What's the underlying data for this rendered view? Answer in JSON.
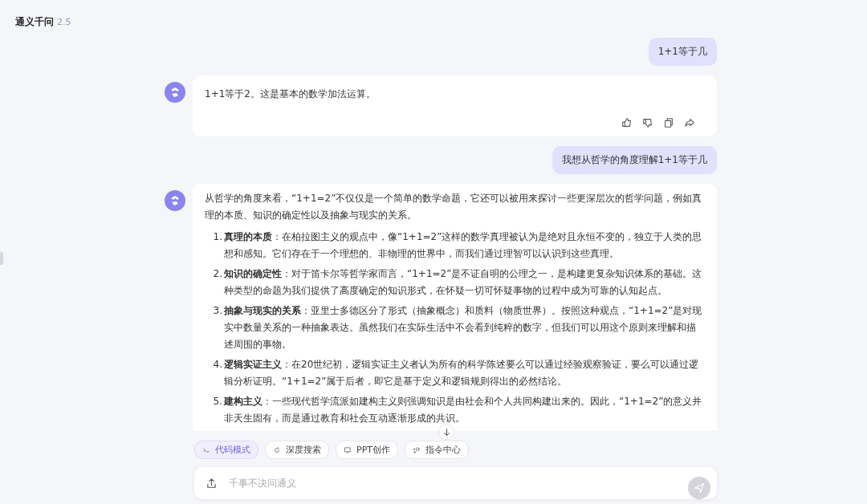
{
  "header": {
    "title": "通义千问",
    "version": "2.5"
  },
  "messages": [
    {
      "kind": "user",
      "text": "1+1等于几"
    },
    {
      "kind": "bot",
      "intro": "1+1等于2。这是基本的数学加法运算。",
      "actions": true
    },
    {
      "kind": "user",
      "text": "我想从哲学的角度理解1+1等于几"
    },
    {
      "kind": "bot",
      "intro": "从哲学的角度来看，“1+1=2”不仅仅是一个简单的数学命题，它还可以被用来探讨一些更深层次的哲学问题，例如真理的本质、知识的确定性以及抽象与现实的关系。",
      "items": [
        {
          "number": "1.",
          "text": "**真理的本质**：在柏拉图主义的观点中，像“1+1=2”这样的数学真理被认为是绝对且永恒不变的，独立于人类的思想和感知。它们存在于一个理想的、非物理的世界中，而我们通过理智可以认识到这些真理。"
        },
        {
          "number": "2.",
          "text": "**知识的确定性**：对于笛卡尔等哲学家而言，“1+1=2”是不证自明的公理之一，是构建更复杂知识体系的基础。这种类型的命题为我们提供了高度确定的知识形式，在怀疑一切可怀疑事物的过程中成为可靠的认知起点。"
        },
        {
          "number": "3.",
          "text": "**抽象与现实的关系**：亚里士多德区分了形式（抽象概念）和质料（物质世界）。按照这种观点，“1+1=2”是对现实中数量关系的一种抽象表达。虽然我们在实际生活中不会看到纯粹的数字，但我们可以用这个原则来理解和描述周围的事物。"
        },
        {
          "number": "4.",
          "text": "**逻辑实证主义**：在20世纪初，逻辑实证主义者认为所有的科学陈述要么可以通过经验观察验证，要么可以通过逻辑分析证明。“1+1=2”属于后者，即它是基于定义和逻辑规则得出的必然结论。"
        },
        {
          "number": "5.",
          "text": "**建构主义**：一些现代哲学流派如建构主义则强调知识是由社会和个人共同构建出来的。因此，“1+1=2”的意义并非天生固有，而是通过教育和社会互动逐渐形成的共识。"
        }
      ]
    }
  ],
  "chips": [
    {
      "label": "代码模式",
      "kind": "code",
      "selected": true
    },
    {
      "label": "深度搜索",
      "kind": "search",
      "selected": false
    },
    {
      "label": "PPT创作",
      "kind": "ppt",
      "selected": false
    },
    {
      "label": "指令中心",
      "kind": "command",
      "selected": false
    }
  ],
  "input": {
    "placeholder": "千事不决问通义"
  }
}
